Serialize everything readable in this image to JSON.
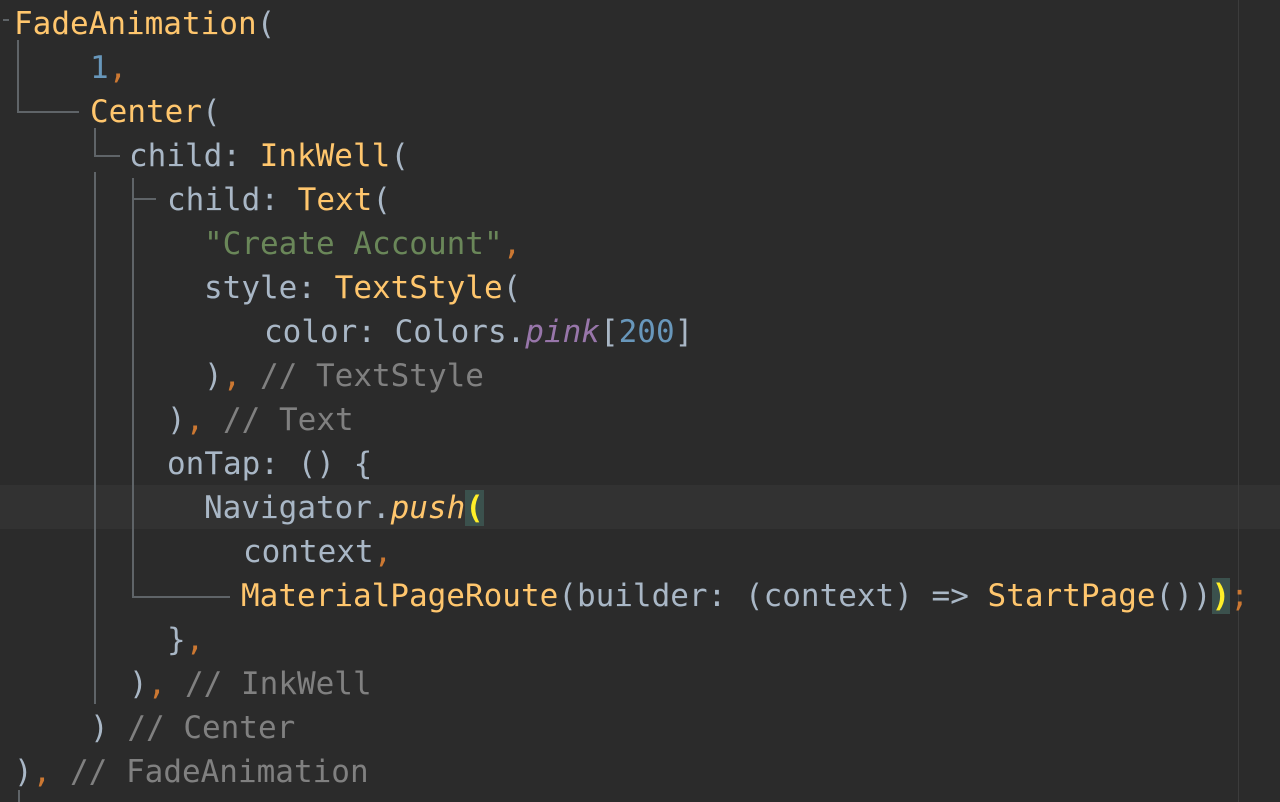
{
  "editor": {
    "colors": {
      "background": "#2b2b2b",
      "caret_row": "#323232",
      "class_name": "#ffc66d",
      "plain": "#a9b7c6",
      "number": "#6897bb",
      "string": "#6a8759",
      "keyword": "#cc7832",
      "comment": "#808080",
      "static_member": "#9876aa",
      "method_call": "#ffc66d",
      "brace_match": "#ffef28",
      "indent_guide": "#5f6468"
    },
    "lines": [
      {
        "tokens": [
          {
            "t": "FadeAnimation",
            "k": "cls"
          },
          {
            "t": "(",
            "k": "plain"
          }
        ]
      },
      {
        "tokens": [
          {
            "t": "1",
            "k": "num"
          },
          {
            "t": ",",
            "k": "kw"
          }
        ]
      },
      {
        "tokens": [
          {
            "t": "Center",
            "k": "cls"
          },
          {
            "t": "(",
            "k": "plain"
          }
        ]
      },
      {
        "tokens": [
          {
            "t": "child: ",
            "k": "plain"
          },
          {
            "t": "InkWell",
            "k": "cls"
          },
          {
            "t": "(",
            "k": "plain"
          }
        ]
      },
      {
        "tokens": [
          {
            "t": "child: ",
            "k": "plain"
          },
          {
            "t": "Text",
            "k": "cls"
          },
          {
            "t": "(",
            "k": "plain"
          }
        ]
      },
      {
        "tokens": [
          {
            "t": "\"Create Account\"",
            "k": "str"
          },
          {
            "t": ",",
            "k": "kw"
          }
        ]
      },
      {
        "tokens": [
          {
            "t": "style: ",
            "k": "plain"
          },
          {
            "t": "TextStyle",
            "k": "cls"
          },
          {
            "t": "(",
            "k": "plain"
          }
        ]
      },
      {
        "tokens": [
          {
            "t": "color: Colors.",
            "k": "plain"
          },
          {
            "t": "pink",
            "k": "static"
          },
          {
            "t": "[",
            "k": "plain"
          },
          {
            "t": "200",
            "k": "num"
          },
          {
            "t": "]",
            "k": "plain"
          }
        ]
      },
      {
        "tokens": [
          {
            "t": ")",
            "k": "plain"
          },
          {
            "t": ", ",
            "k": "kw"
          },
          {
            "t": "// TextStyle",
            "k": "cmt"
          }
        ]
      },
      {
        "tokens": [
          {
            "t": ")",
            "k": "plain"
          },
          {
            "t": ", ",
            "k": "kw"
          },
          {
            "t": "// Text",
            "k": "cmt"
          }
        ]
      },
      {
        "tokens": [
          {
            "t": "onTap: () {",
            "k": "plain"
          }
        ]
      },
      {
        "tokens": [
          {
            "t": "Navigator.",
            "k": "plain"
          },
          {
            "t": "push",
            "k": "method"
          },
          {
            "t": "(",
            "k": "brace"
          }
        ]
      },
      {
        "tokens": [
          {
            "t": "context",
            "k": "plain"
          },
          {
            "t": ",",
            "k": "kw"
          }
        ]
      },
      {
        "tokens": [
          {
            "t": "MaterialPageRoute",
            "k": "cls"
          },
          {
            "t": "(builder: (context) => ",
            "k": "plain"
          },
          {
            "t": "StartPage",
            "k": "cls"
          },
          {
            "t": "())",
            "k": "plain"
          },
          {
            "t": ")",
            "k": "brace"
          },
          {
            "t": ";",
            "k": "kw"
          }
        ]
      },
      {
        "tokens": [
          {
            "t": "}",
            "k": "plain"
          },
          {
            "t": ",",
            "k": "kw"
          }
        ]
      },
      {
        "tokens": [
          {
            "t": ")",
            "k": "plain"
          },
          {
            "t": ", ",
            "k": "kw"
          },
          {
            "t": "// InkWell",
            "k": "cmt"
          }
        ]
      },
      {
        "tokens": [
          {
            "t": ") ",
            "k": "plain"
          },
          {
            "t": "// Center",
            "k": "cmt"
          }
        ]
      },
      {
        "tokens": [
          {
            "t": ")",
            "k": "plain"
          },
          {
            "t": ", ",
            "k": "kw"
          },
          {
            "t": "// FadeAnimation",
            "k": "cmt"
          }
        ]
      }
    ]
  }
}
